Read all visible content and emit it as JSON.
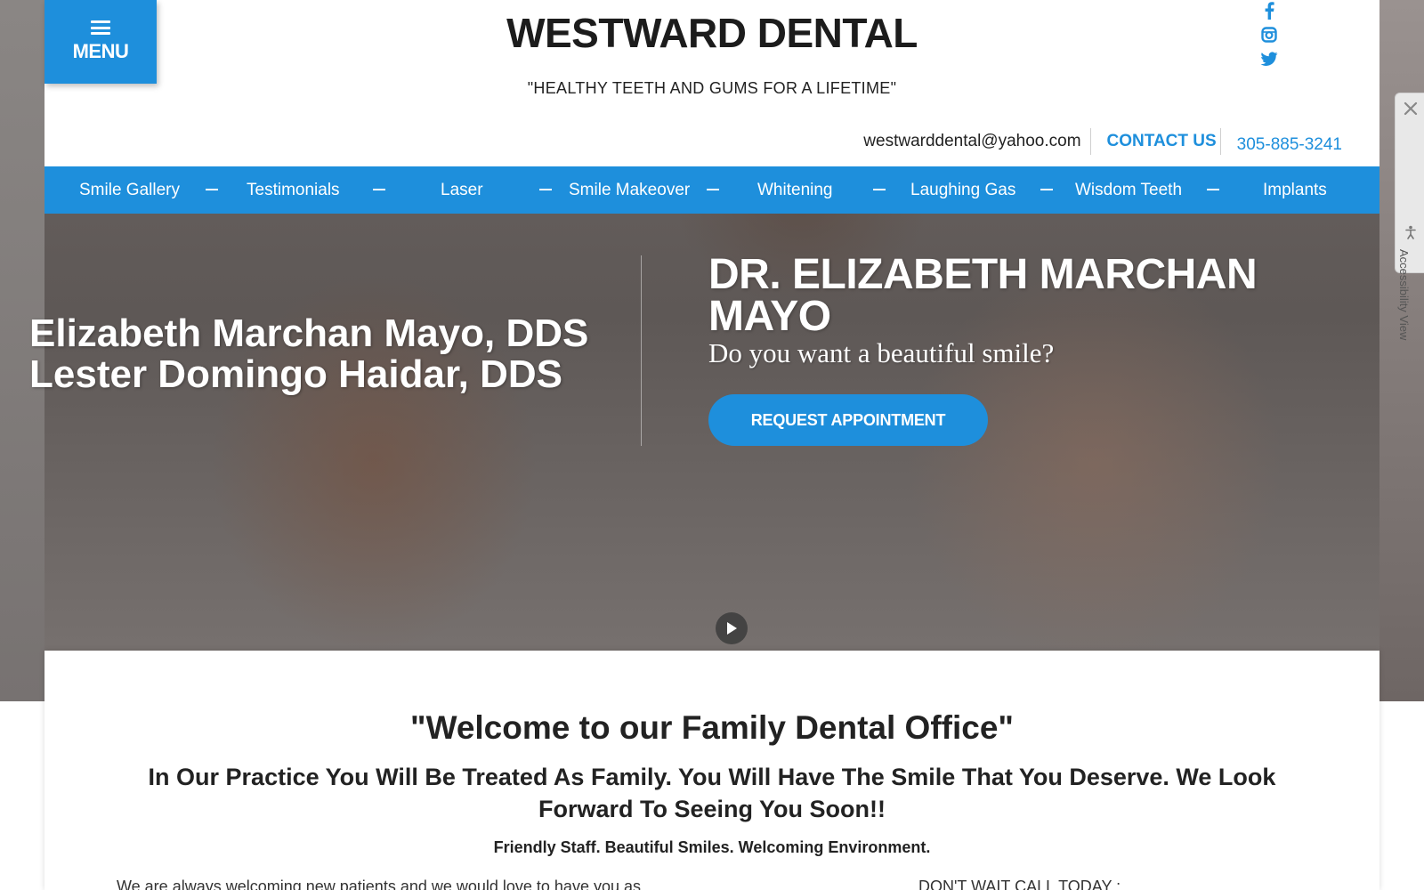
{
  "header": {
    "menu_label": "MENU",
    "title": "WESTWARD DENTAL",
    "tagline": "\"HEALTHY TEETH AND GUMS FOR A LIFETIME\"",
    "social_icons": [
      "facebook-icon",
      "instagram-icon",
      "twitter-icon"
    ],
    "email": "westwarddental@yahoo.com",
    "contact_label": "CONTACT US",
    "phone": "305-885-3241"
  },
  "nav": {
    "items": [
      {
        "label": "Smile Gallery"
      },
      {
        "label": "Testimonials"
      },
      {
        "label": "Laser"
      },
      {
        "label": "Smile Makeover"
      },
      {
        "label": "Whitening"
      },
      {
        "label": "Laughing Gas"
      },
      {
        "label": "Wisdom Teeth"
      },
      {
        "label": "Implants"
      }
    ]
  },
  "hero": {
    "doctor_1": "Elizabeth Marchan Mayo, DDS",
    "doctor_2": "Lester Domingo Haidar, DDS",
    "headline": "DR. ELIZABETH MARCHAN MAYO",
    "question": "Do you want a beautiful smile?",
    "cta_label": "REQUEST APPOINTMENT"
  },
  "accessibility": {
    "label": "Accessibility View"
  },
  "content": {
    "welcome": "\"Welcome to our Family Dental Office\"",
    "practice": "In Our Practice You Will Be Treated As Family. You Will Have The Smile That You Deserve. We Look Forward To Seeing You Soon!!",
    "friendly": "Friendly Staff. Beautiful Smiles. Welcoming Environment.",
    "welcome_new": "We are always welcoming new patients and we would love to have you as",
    "dont_wait": "DON'T WAIT CALL TODAY :"
  },
  "colors": {
    "accent": "#1e8fdc",
    "text": "#222222"
  }
}
